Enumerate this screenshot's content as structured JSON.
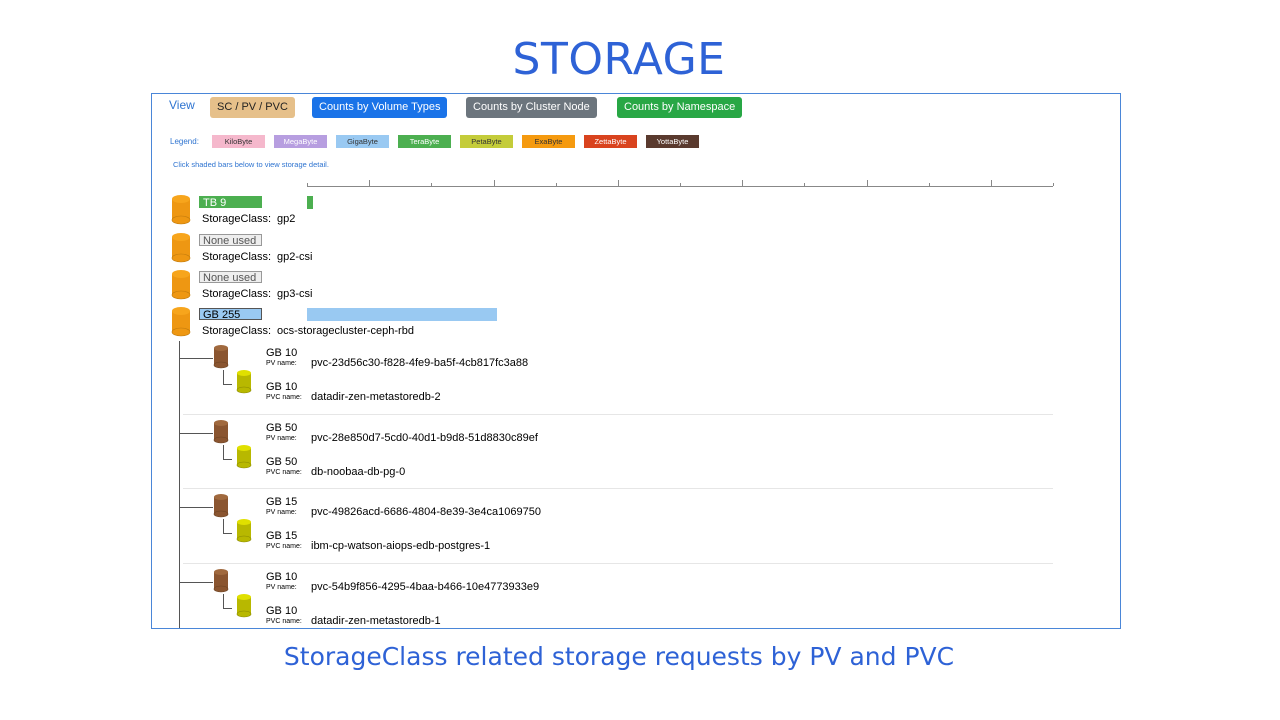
{
  "page": {
    "title": "STORAGE",
    "subtitle": "StorageClass related storage requests by PV and PVC"
  },
  "toolbar": {
    "view_label": "View",
    "buttons": [
      {
        "label": "SC / PV / PVC",
        "bg": "#e6c08a",
        "fg": "#222222"
      },
      {
        "label": "Counts by Volume Types",
        "bg": "#1a73e8",
        "fg": "#ffffff"
      },
      {
        "label": "Counts by Cluster Node",
        "bg": "#6c757d",
        "fg": "#ffffff"
      },
      {
        "label": "Counts by Namespace",
        "bg": "#28a745",
        "fg": "#ffffff"
      }
    ]
  },
  "legend": {
    "label": "Legend:",
    "items": [
      {
        "label": "KiloByte",
        "color": "#f5b8cc",
        "fg": "#333333"
      },
      {
        "label": "MegaByte",
        "color": "#b79ee0",
        "fg": "#ffffff"
      },
      {
        "label": "GigaByte",
        "color": "#99c9f2",
        "fg": "#333333"
      },
      {
        "label": "TeraByte",
        "color": "#4caf50",
        "fg": "#ffffff"
      },
      {
        "label": "PetaByte",
        "color": "#c4cc3a",
        "fg": "#333333"
      },
      {
        "label": "ExaByte",
        "color": "#f59a0f",
        "fg": "#333333"
      },
      {
        "label": "ZettaByte",
        "color": "#d9431e",
        "fg": "#ffffff"
      },
      {
        "label": "YottaByte",
        "color": "#5a3a2e",
        "fg": "#ffffff"
      }
    ]
  },
  "hint": "Click shaded bars below to view storage detail.",
  "scale_ticks": 13,
  "storage_classes": [
    {
      "badge": "TB 9",
      "badge_unit": "TeraByte",
      "label": "StorageClass:",
      "name": "gp2",
      "bar_fraction": 0.008,
      "bar_color": "#4caf50"
    },
    {
      "badge": "None used",
      "badge_unit": "none",
      "label": "StorageClass:",
      "name": "gp2-csi",
      "bar_fraction": 0,
      "bar_color": ""
    },
    {
      "badge": "None used",
      "badge_unit": "none",
      "label": "StorageClass:",
      "name": "gp3-csi",
      "bar_fraction": 0,
      "bar_color": ""
    },
    {
      "badge": "GB 255",
      "badge_unit": "GigaByte",
      "label": "StorageClass:",
      "name": "ocs-storagecluster-ceph-rbd",
      "bar_fraction": 0.255,
      "bar_color": "#99c9f2"
    }
  ],
  "pv_entries": [
    {
      "pv_size": "GB 10",
      "pv_label": "PV name:",
      "pv_name": "pvc-23d56c30-f828-4fe9-ba5f-4cb817fc3a88",
      "pvc_size": "GB 10",
      "pvc_label": "PVC name:",
      "pvc_name": "datadir-zen-metastoredb-2"
    },
    {
      "pv_size": "GB 50",
      "pv_label": "PV name:",
      "pv_name": "pvc-28e850d7-5cd0-40d1-b9d8-51d8830c89ef",
      "pvc_size": "GB 50",
      "pvc_label": "PVC name:",
      "pvc_name": "db-noobaa-db-pg-0"
    },
    {
      "pv_size": "GB 15",
      "pv_label": "PV name:",
      "pv_name": "pvc-49826acd-6686-4804-8e39-3e4ca1069750",
      "pvc_size": "GB 15",
      "pvc_label": "PVC name:",
      "pvc_name": "ibm-cp-watson-aiops-edb-postgres-1"
    },
    {
      "pv_size": "GB 10",
      "pv_label": "PV name:",
      "pv_name": "pvc-54b9f856-4295-4baa-b466-10e4773933e9",
      "pvc_size": "GB 10",
      "pvc_label": "PVC name:",
      "pvc_name": "datadir-zen-metastoredb-1"
    }
  ]
}
